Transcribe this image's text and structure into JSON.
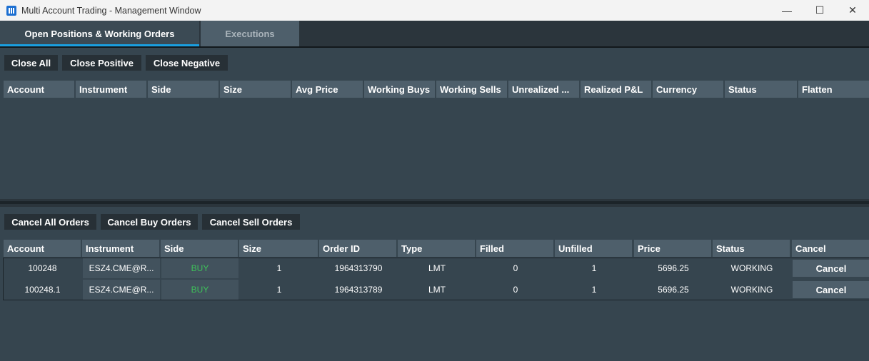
{
  "window": {
    "title": "Multi Account Trading - Management Window",
    "minimize": "—",
    "maximize": "☐",
    "close": "✕"
  },
  "tabs": [
    {
      "label": "Open Positions & Working Orders",
      "active": true
    },
    {
      "label": "Executions",
      "active": false
    }
  ],
  "positions": {
    "buttons": {
      "close_all": "Close All",
      "close_positive": "Close Positive",
      "close_negative": "Close Negative"
    },
    "columns": [
      "Account",
      "Instrument",
      "Side",
      "Size",
      "Avg Price",
      "Working Buys",
      "Working Sells",
      "Unrealized ...",
      "Realized P&L",
      "Currency",
      "Status",
      "Flatten"
    ]
  },
  "orders": {
    "buttons": {
      "cancel_all": "Cancel All Orders",
      "cancel_buy": "Cancel Buy Orders",
      "cancel_sell": "Cancel Sell Orders"
    },
    "columns": [
      "Account",
      "Instrument",
      "Side",
      "Size",
      "Order ID",
      "Type",
      "Filled",
      "Unfilled",
      "Price",
      "Status",
      "Cancel"
    ],
    "rows": [
      {
        "account": "100248",
        "instrument": "ESZ4.CME@R...",
        "side": "BUY",
        "size": "1",
        "order_id": "1964313790",
        "type": "LMT",
        "filled": "0",
        "unfilled": "1",
        "price": "5696.25",
        "status": "WORKING",
        "cancel": "Cancel"
      },
      {
        "account": "100248.1",
        "instrument": "ESZ4.CME@R...",
        "side": "BUY",
        "size": "1",
        "order_id": "1964313789",
        "type": "LMT",
        "filled": "0",
        "unfilled": "1",
        "price": "5696.25",
        "status": "WORKING",
        "cancel": "Cancel"
      }
    ]
  },
  "colors": {
    "background": "#36454f",
    "header": "#4e5f6b",
    "button": "#273036",
    "accent": "#1a9fe0",
    "buy": "#3ec25a"
  }
}
